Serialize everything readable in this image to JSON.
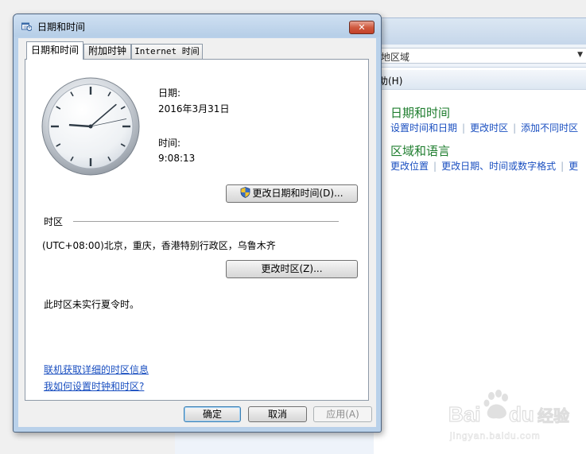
{
  "background_window": {
    "address_text": "地区域",
    "menu_help": "助(H)",
    "categories": [
      {
        "heading": "日期和时间",
        "links": [
          "设置时间和日期",
          "更改时区",
          "添加不同时区"
        ]
      },
      {
        "heading": "区域和语言",
        "links": [
          "更改位置",
          "更改日期、时间或数字格式",
          "更"
        ]
      }
    ]
  },
  "dialog": {
    "title": "日期和时间",
    "close_glyph": "✕",
    "tabs": [
      "日期和时间",
      "附加时钟",
      "Internet 时间"
    ],
    "active_tab": 0,
    "date_label": "日期:",
    "date_value": "2016年3月31日",
    "time_label": "时间:",
    "time_value": "9:08:13",
    "change_datetime_button": "更改日期和时间(D)...",
    "timezone_label": "时区",
    "timezone_value": "(UTC+08:00)北京，重庆，香港特别行政区，乌鲁木齐",
    "change_timezone_button": "更改时区(Z)...",
    "dst_note": "此时区未实行夏令时。",
    "link_online_info": "联机获取详细的时区信息",
    "link_how_to": "我如何设置时钟和时区?",
    "ok_button": "确定",
    "cancel_button": "取消",
    "apply_button": "应用(A)"
  },
  "clock": {
    "hours": 9,
    "minutes": 8,
    "seconds": 13
  },
  "icons": {
    "title": "calendar-clock-icon",
    "shield": "uac-shield-icon",
    "close": "close-icon"
  },
  "colors": {
    "link": "#1a4fc0",
    "heading_green": "#1e7d2e",
    "title_bar": "#b9d1ea"
  },
  "watermark": {
    "logo_text": "Bai du 经验",
    "url": "jingyan.baidu.com"
  }
}
